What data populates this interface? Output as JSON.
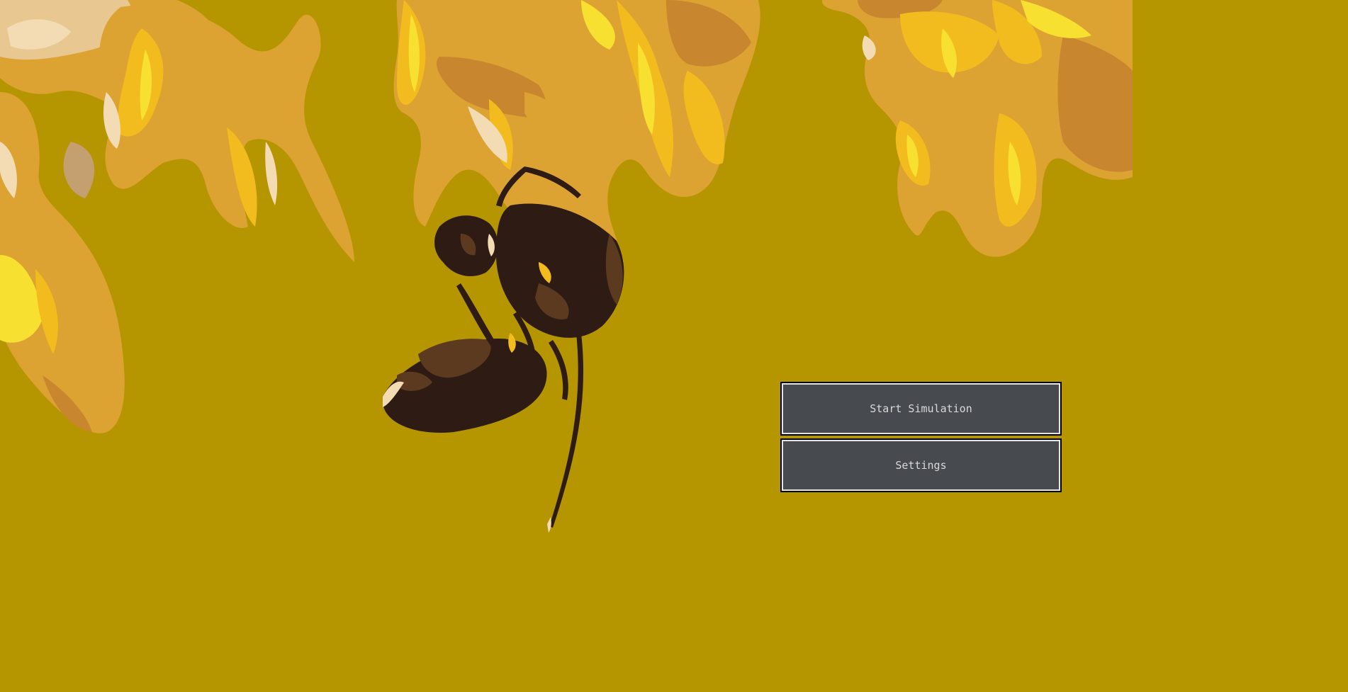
{
  "menu": {
    "start_label": "Start Simulation",
    "settings_label": "Settings"
  },
  "colors": {
    "background": "#b59500",
    "button_fill": "#474a4f",
    "button_border": "#e4e4e4",
    "button_text": "#d9d9d9",
    "flower_dark": "#c8862e",
    "flower_mid": "#dca232",
    "flower_light": "#f2bc1e",
    "flower_bright": "#f8e030",
    "flower_cream": "#f3dcb4",
    "bee_dark": "#2e1c14",
    "bee_brown": "#5c3a20"
  },
  "icons": {
    "background_art": "bee-on-flowers-illustration"
  }
}
